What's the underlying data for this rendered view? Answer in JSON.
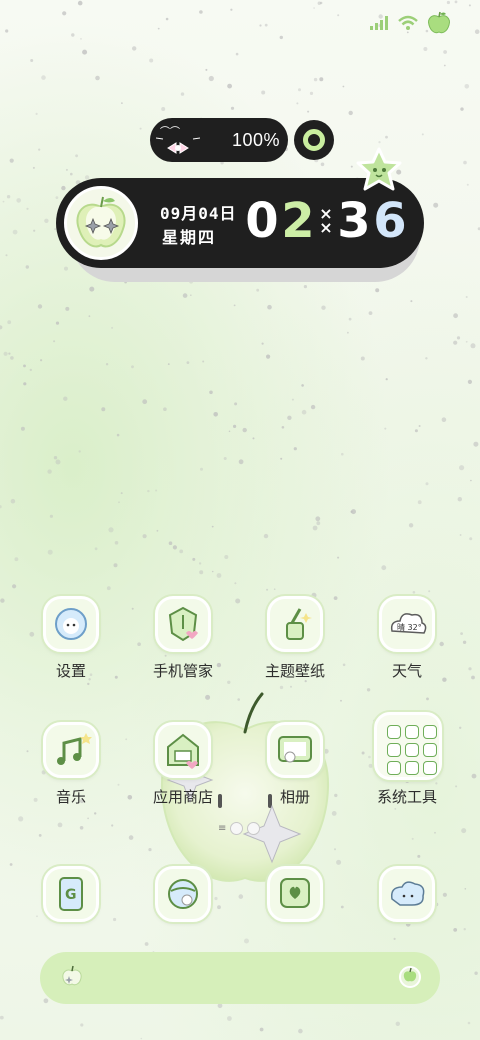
{
  "status_bar": {
    "icons": [
      "signal-icon",
      "wifi-icon",
      "apple-battery-icon"
    ]
  },
  "battery_widget": {
    "percent_text": "100%",
    "level": 1.0
  },
  "clock_widget": {
    "date": "09月04日",
    "weekday": "星期四",
    "hour_tens": "0",
    "hour_ones": "2",
    "minute_tens": "3",
    "minute_ones": "6",
    "separator": "×\n×",
    "colors": {
      "digit_white": "#ffffff",
      "digit_green": "#cdeea6",
      "digit_blue": "#d3e6fa"
    }
  },
  "apps_row1": [
    {
      "label": "设置",
      "icon": "gear-cat-icon"
    },
    {
      "label": "手机管家",
      "icon": "shield-heart-icon"
    },
    {
      "label": "主题壁纸",
      "icon": "paint-brush-icon"
    },
    {
      "label": "天气",
      "icon": "weather-cloud-icon",
      "badge": "晴 32°"
    }
  ],
  "apps_row2": [
    {
      "label": "音乐",
      "icon": "music-note-icon"
    },
    {
      "label": "应用商店",
      "icon": "shop-house-icon"
    },
    {
      "label": "相册",
      "icon": "photo-album-icon"
    },
    {
      "label": "系统工具",
      "icon": "folder-icon"
    }
  ],
  "apps_row3": [
    {
      "icon": "google-phone-icon"
    },
    {
      "icon": "globe-cat-icon"
    },
    {
      "icon": "heart-note-icon"
    },
    {
      "icon": "bubble-cloud-icon"
    }
  ],
  "page_indicator": {
    "lines_glyph": "≡"
  },
  "dock": {
    "left_icon": "apple-icon",
    "right_icon": "apple-icon"
  },
  "colors": {
    "accent_green": "#cdeea6",
    "dark": "#1f1f1f",
    "dock_bg": "#d6efba"
  }
}
